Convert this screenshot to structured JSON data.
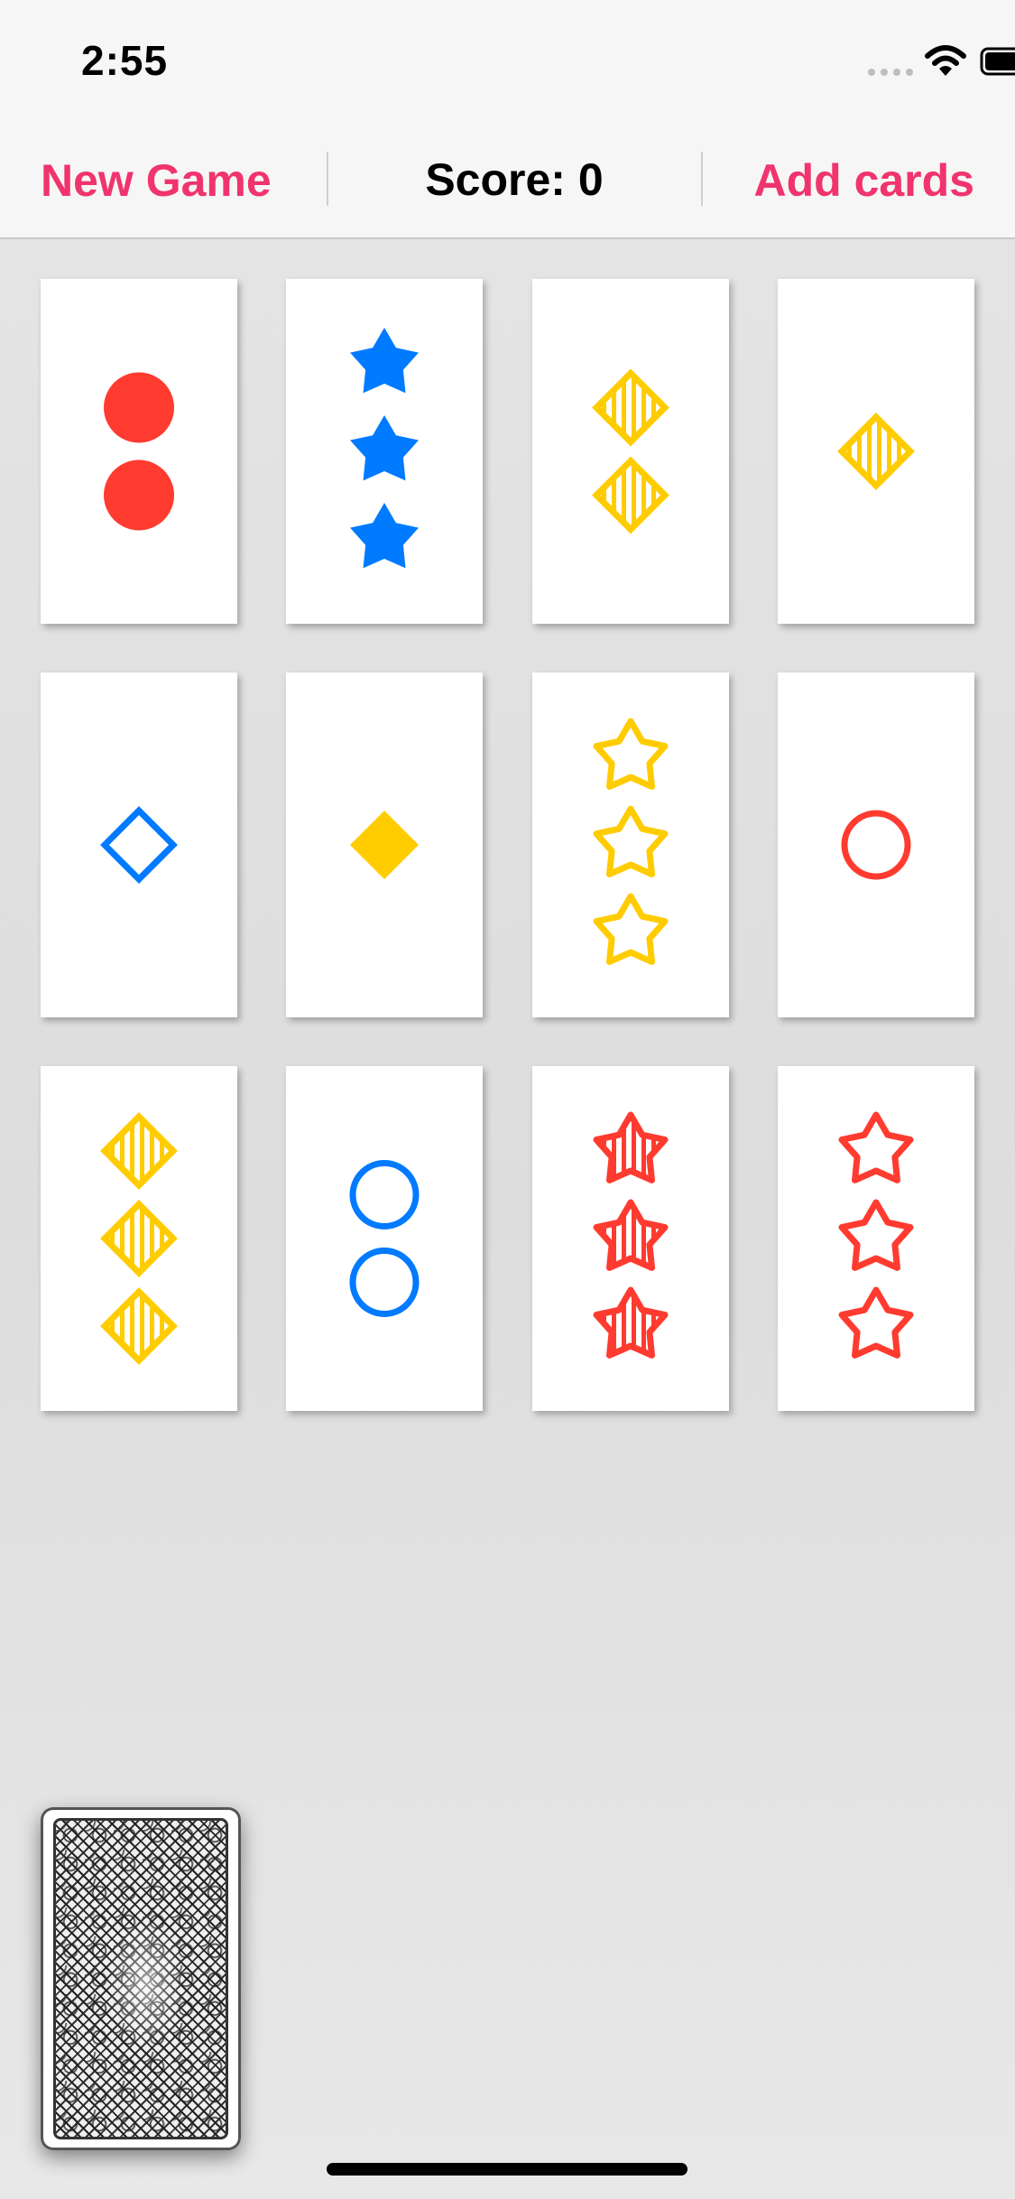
{
  "status": {
    "time": "2:55"
  },
  "toolbar": {
    "new_game_label": "New Game",
    "score_text": "Score: 0",
    "add_cards_label": "Add cards"
  },
  "colors": {
    "accent": "#f0346e",
    "red": "#ff3b30",
    "blue": "#007aff",
    "yellow": "#ffcc00"
  },
  "cards": [
    {
      "count": 2,
      "shape": "circle",
      "color": "red",
      "fill": "solid"
    },
    {
      "count": 3,
      "shape": "star",
      "color": "blue",
      "fill": "solid"
    },
    {
      "count": 2,
      "shape": "diamond",
      "color": "yellow",
      "fill": "striped"
    },
    {
      "count": 1,
      "shape": "diamond",
      "color": "yellow",
      "fill": "striped"
    },
    {
      "count": 1,
      "shape": "diamond",
      "color": "blue",
      "fill": "open"
    },
    {
      "count": 1,
      "shape": "diamond",
      "color": "yellow",
      "fill": "solid"
    },
    {
      "count": 3,
      "shape": "star",
      "color": "yellow",
      "fill": "open"
    },
    {
      "count": 1,
      "shape": "circle",
      "color": "red",
      "fill": "open"
    },
    {
      "count": 3,
      "shape": "diamond",
      "color": "yellow",
      "fill": "striped"
    },
    {
      "count": 2,
      "shape": "circle",
      "color": "blue",
      "fill": "open"
    },
    {
      "count": 3,
      "shape": "star",
      "color": "red",
      "fill": "striped"
    },
    {
      "count": 3,
      "shape": "star",
      "color": "red",
      "fill": "open"
    }
  ],
  "deck": {
    "icon": "card-back-pattern"
  }
}
